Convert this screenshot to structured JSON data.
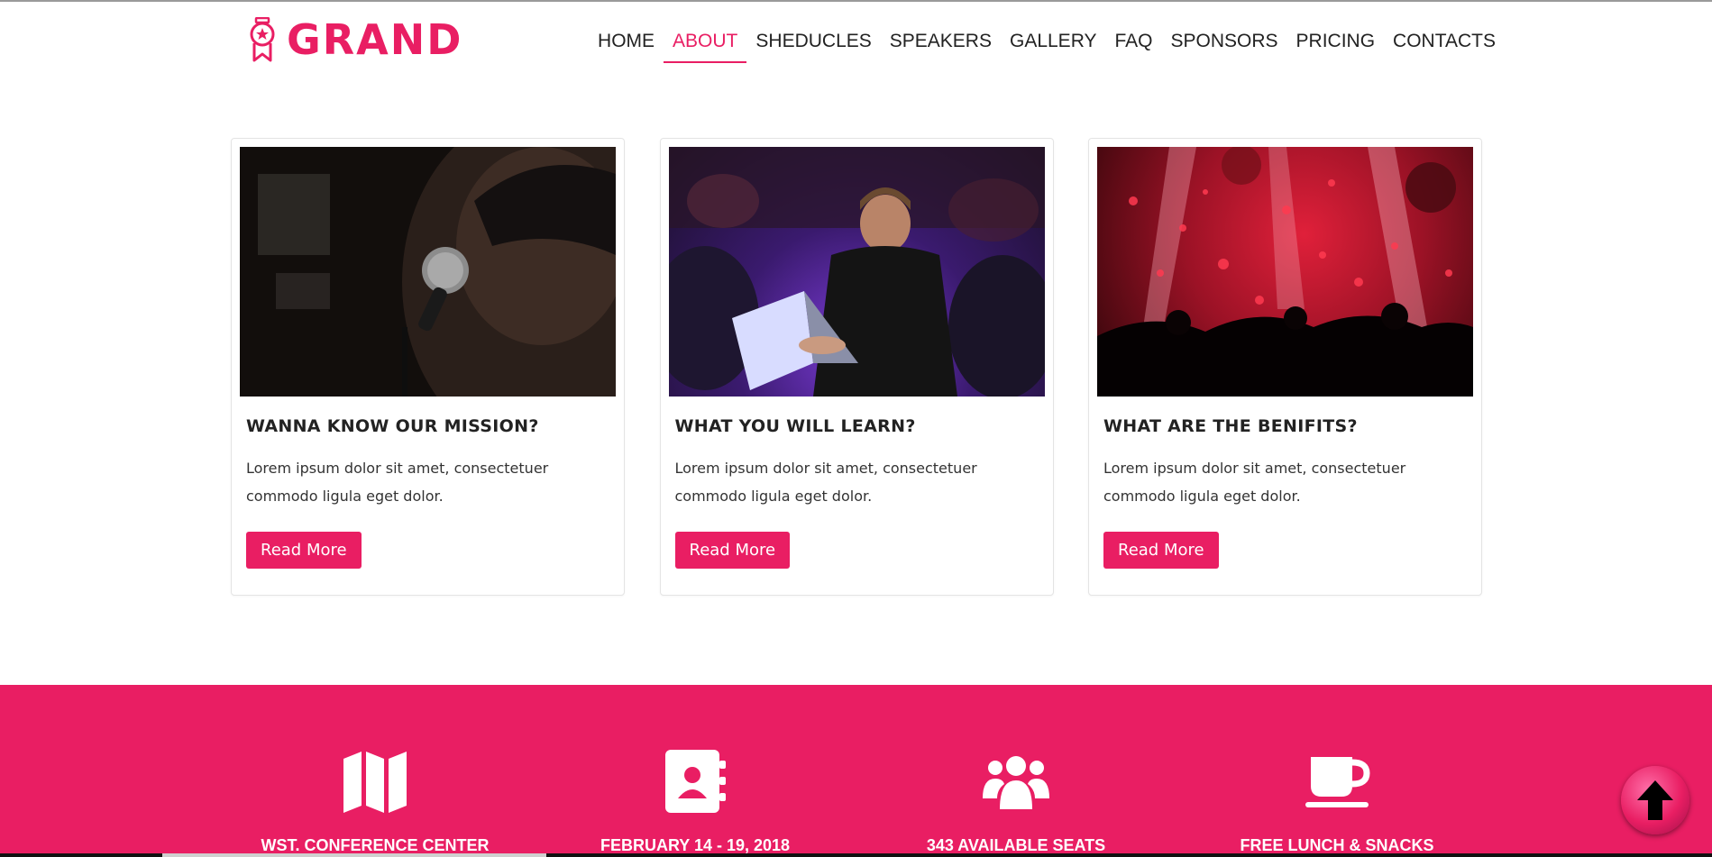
{
  "brand": {
    "name": "GRAND",
    "color": "#e91e63"
  },
  "nav": {
    "items": [
      {
        "label": "HOME",
        "active": false
      },
      {
        "label": "ABOUT",
        "active": true
      },
      {
        "label": "SHEDUCLES",
        "active": false
      },
      {
        "label": "SPEAKERS",
        "active": false
      },
      {
        "label": "GALLERY",
        "active": false
      },
      {
        "label": "FAQ",
        "active": false
      },
      {
        "label": "SPONSORS",
        "active": false
      },
      {
        "label": "PRICING",
        "active": false
      },
      {
        "label": "CONTACTS",
        "active": false
      }
    ]
  },
  "cards": [
    {
      "title": "WANNA KNOW OUR MISSION?",
      "text": "Lorem ipsum dolor sit amet, consectetuer commodo ligula eget dolor.",
      "button": "Read More",
      "image": "speaker-with-microphone-photo"
    },
    {
      "title": "WHAT YOU WILL LEARN?",
      "text": "Lorem ipsum dolor sit amet, consectetuer commodo ligula eget dolor.",
      "button": "Read More",
      "image": "man-with-laptop-photo"
    },
    {
      "title": "WHAT ARE THE BENIFITS?",
      "text": "Lorem ipsum dolor sit amet, consectetuer commodo ligula eget dolor.",
      "button": "Read More",
      "image": "party-confetti-photo"
    }
  ],
  "features": [
    {
      "icon": "map-icon",
      "label": "WST. CONFERENCE CENTER"
    },
    {
      "icon": "contact-book-icon",
      "label": "FEBRUARY 14 - 19, 2018"
    },
    {
      "icon": "group-icon",
      "label": "343 AVAILABLE SEATS"
    },
    {
      "icon": "coffee-cup-icon",
      "label": "FREE LUNCH & SNACKS"
    }
  ],
  "colors": {
    "accent": "#e91e63",
    "text": "#222222"
  }
}
